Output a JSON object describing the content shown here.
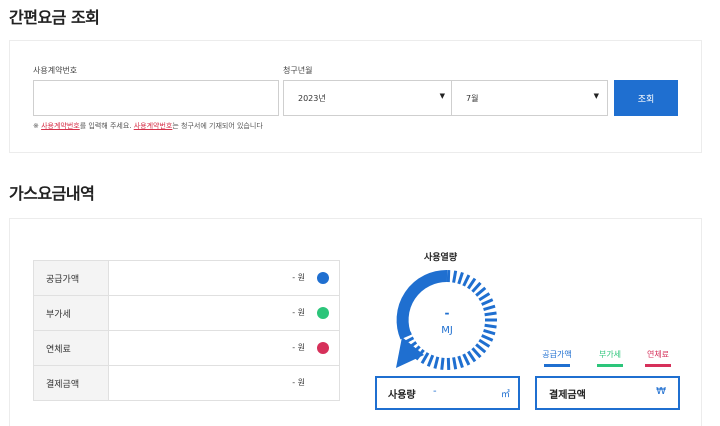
{
  "section1": {
    "title": "간편요금 조회"
  },
  "search": {
    "contract_label": "사용계약번호",
    "contract_value": "",
    "month_label": "청구년월",
    "year_value": "2023년",
    "month_value": "7월",
    "button_label": "조회",
    "notice_prefix": "※ ",
    "notice_link1": "사용계약번호",
    "notice_mid": "를 입력해 주세요. ",
    "notice_link2": "사용계약번호",
    "notice_suffix": "는 청구서에 기재되어 있습니다"
  },
  "section2": {
    "title": "가스요금내역"
  },
  "fees": [
    {
      "label": "공급가액",
      "amount": "- 원",
      "color": "#1f6fd0"
    },
    {
      "label": "부가세",
      "amount": "- 원",
      "color": "#2cc57a"
    },
    {
      "label": "연체료",
      "amount": "- 원",
      "color": "#d6305a"
    },
    {
      "label": "결제금액",
      "amount": "- 원"
    }
  ],
  "gauge": {
    "title": "사용열량",
    "value": "-",
    "unit": "MJ",
    "color": "#1f6fd0"
  },
  "usage": {
    "label": "사용량",
    "value": "-",
    "unit": "㎥"
  },
  "legend": [
    {
      "label": "공급가액",
      "color": "#1f6fd0"
    },
    {
      "label": "부가세",
      "color": "#2cc57a"
    },
    {
      "label": "연체료",
      "color": "#d6305a"
    }
  ],
  "payment": {
    "label": "결제금액",
    "unit": "₩"
  }
}
